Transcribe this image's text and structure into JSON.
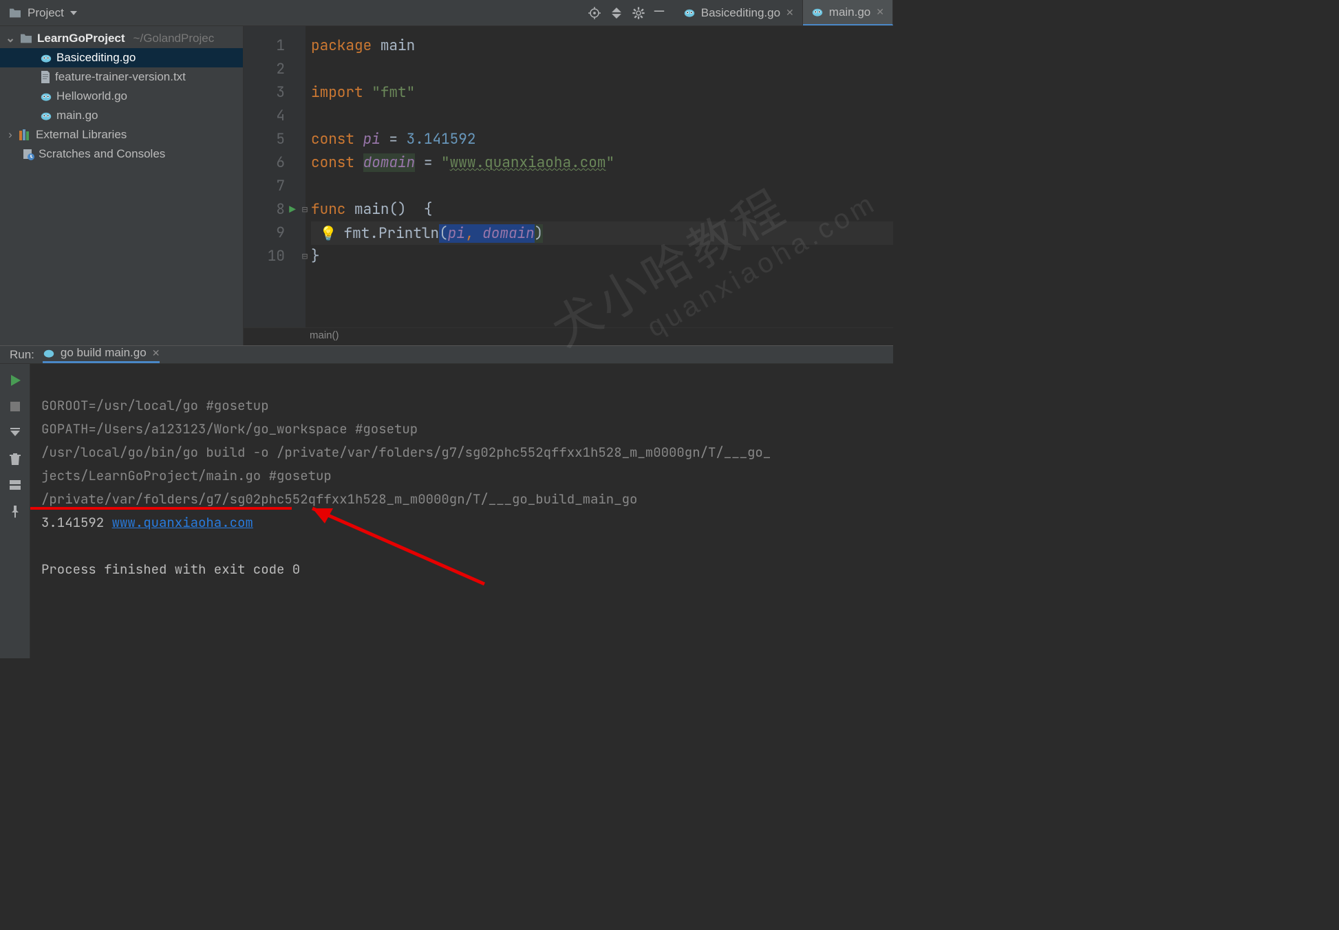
{
  "toolbar": {
    "project_label": "Project"
  },
  "tabs": [
    {
      "label": "Basicediting.go",
      "active": false
    },
    {
      "label": "main.go",
      "active": true
    }
  ],
  "sidebar": {
    "project_name": "LearnGoProject",
    "project_path": "~/GolandProjec",
    "files": [
      "Basicediting.go",
      "feature-trainer-version.txt",
      "Helloworld.go",
      "main.go"
    ],
    "external_libraries": "External Libraries",
    "scratches": "Scratches and Consoles"
  },
  "code": {
    "l1_kw": "package",
    "l1_id": "main",
    "l3_kw": "import",
    "l3_str": "\"fmt\"",
    "l5_kw": "const",
    "l5_ci": "pi",
    "l5_eq": "=",
    "l5_num": "3.141592",
    "l6_kw": "const",
    "l6_ci": "domain",
    "l6_eq": "=",
    "l6_str_open": "\"",
    "l6_str_link": "www.quanxiaoha.com",
    "l6_str_close": "\"",
    "l8_kw": "func",
    "l8_id": "main",
    "l8_par": "()",
    "l8_brace": "{",
    "l9_call_obj": "fmt",
    "l9_call_dot": ".",
    "l9_call_fn": "Println",
    "l9_open": "(",
    "l9_a1": "pi",
    "l9_comma": ",",
    "l9_a2": "domain",
    "l9_close": ")",
    "l10_brace": "}",
    "line_numbers": [
      "1",
      "2",
      "3",
      "4",
      "5",
      "6",
      "7",
      "8",
      "9",
      "10"
    ],
    "breadcrumb": "main()"
  },
  "run": {
    "label": "Run:",
    "tab_label": "go build main.go",
    "console_lines": {
      "l1": "GOROOT=/usr/local/go #gosetup",
      "l2": "GOPATH=/Users/a123123/Work/go_workspace #gosetup",
      "l3": "/usr/local/go/bin/go build -o /private/var/folders/g7/sg02phc552qffxx1h528_m_m0000gn/T/___go_",
      "l4": "jects/LearnGoProject/main.go #gosetup",
      "l5": "/private/var/folders/g7/sg02phc552qffxx1h528_m_m0000gn/T/___go_build_main_go",
      "l6_num": "3.141592 ",
      "l6_link": "www.quanxiaoha.com",
      "l8": "Process finished with exit code 0"
    }
  },
  "watermark1": "犬小哈教程",
  "watermark2": "quanxiaoha.com"
}
